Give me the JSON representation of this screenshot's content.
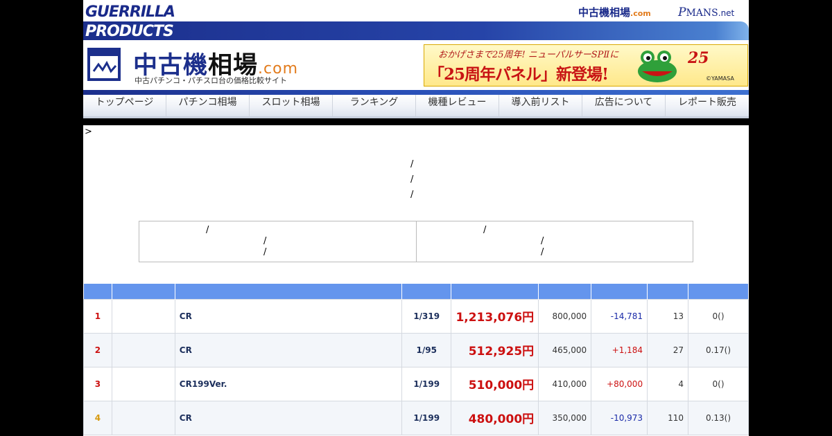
{
  "header": {
    "brand_line1": "GUERRILLA",
    "brand_line2": "PRODUCTS",
    "site_link_main": "中古機相場",
    "site_link_suffix": ".com",
    "pmans_logo": "P",
    "pmans_text": "MANS",
    "pmans_suffix": ".net",
    "logo_icon": "chart-window-icon",
    "logo_main": "中古機",
    "logo_accent": "相場",
    "logo_suffix": ".com",
    "logo_subtitle": "中古パチンコ・パチスロ台の価格比較サイト"
  },
  "banner": {
    "line1": "おかげさまで25周年! ニューパルサーSPⅡに",
    "line2": "「25周年パネル」新登場!",
    "badge": "25",
    "copyright": "©YAMASA",
    "mascot_icon": "frog-mascot-icon"
  },
  "nav": [
    "トップページ",
    "パチンコ相場",
    "スロット相場",
    "ランキング",
    "機種レビュー",
    "導入前リスト",
    "広告について",
    "レポート販売"
  ],
  "content": {
    "breadcrumb_marker": ">",
    "slash": "/"
  },
  "table": {
    "header_color": "#6495ed",
    "rows": [
      {
        "rank": "1",
        "name": "CR",
        "prob": "1/319",
        "price": "1,213,076円",
        "prev": "800,000",
        "diff": "-14,781",
        "count": "13",
        "rate": "0()"
      },
      {
        "rank": "2",
        "name": "CR",
        "prob": "1/95",
        "price": "512,925円",
        "prev": "465,000",
        "diff": "+1,184",
        "count": "27",
        "rate": "0.17()"
      },
      {
        "rank": "3",
        "name": "CR199Ver.",
        "prob": "1/199",
        "price": "510,000円",
        "prev": "410,000",
        "diff": "+80,000",
        "count": "4",
        "rate": "0()"
      },
      {
        "rank": "4",
        "name": "CR",
        "prob": "1/199",
        "price": "480,000円",
        "prev": "350,000",
        "diff": "-10,973",
        "count": "110",
        "rate": "0.13()"
      }
    ]
  }
}
